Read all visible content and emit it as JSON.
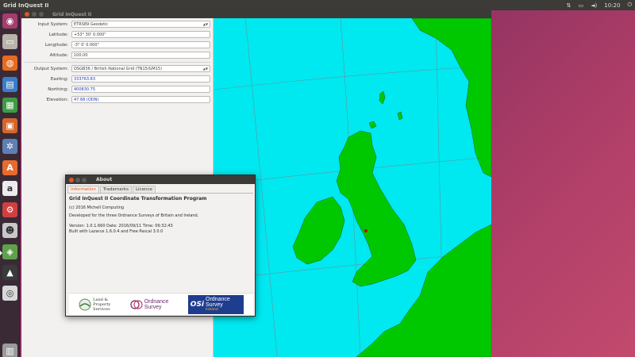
{
  "top_panel": {
    "title": "Grid InQuest II",
    "clock": "10:20"
  },
  "launcher": {
    "items": [
      {
        "name": "dash-home-icon",
        "color": "#a33d6d",
        "glyph": "◉"
      },
      {
        "name": "files-icon",
        "color": "#b9b4ab",
        "glyph": "▭"
      },
      {
        "name": "firefox-icon",
        "color": "#e66b1f",
        "glyph": "◍"
      },
      {
        "name": "writer-icon",
        "color": "#3a7dc9",
        "glyph": "▤"
      },
      {
        "name": "calc-icon",
        "color": "#3f9b45",
        "glyph": "▦"
      },
      {
        "name": "impress-icon",
        "color": "#d5652a",
        "glyph": "▣"
      },
      {
        "name": "settings-icon",
        "color": "#5f7fb3",
        "glyph": "✲"
      },
      {
        "name": "software-center-icon",
        "color": "#e86a2c",
        "glyph": "A"
      },
      {
        "name": "amazon-icon",
        "color": "#ececec",
        "glyph": "a"
      },
      {
        "name": "system-settings-icon",
        "color": "#d23f3f",
        "glyph": "⚙"
      },
      {
        "name": "user-accounts-icon",
        "color": "#c8c8c8",
        "glyph": "☻"
      },
      {
        "name": "grid-inquest-icon",
        "color": "#5fa14a",
        "glyph": "◈"
      },
      {
        "name": "inkscape-icon",
        "color": "#3a3a3a",
        "glyph": "▲"
      },
      {
        "name": "dvd-icon",
        "color": "#d8d8d8",
        "glyph": "◎"
      },
      {
        "name": "trash-icon",
        "color": "#9a9a9a",
        "glyph": "▥"
      }
    ]
  },
  "main_window": {
    "title": "Grid InQuest II",
    "input": {
      "system_label": "Input System:",
      "system_value": "ETRS89 Geodetic",
      "latitude_label": "Latitude:",
      "latitude_value": "+53° 30' 0.000\"",
      "longitude_label": "Longitude:",
      "longitude_value": "-3° 0' 0.000\"",
      "altitude_label": "Altitude:",
      "altitude_value": "100.00"
    },
    "output": {
      "system_label": "Output System:",
      "system_value": "OSGB36 / British National Grid (TN15/GM15)",
      "easting_label": "Easting:",
      "easting_value": "333763.83",
      "northing_label": "Northing:",
      "northing_value": "400830.75",
      "elevation_label": "Elevation:",
      "elevation_value": "47.68 (ODN)"
    }
  },
  "about_dialog": {
    "title": "About",
    "tabs": [
      "Information",
      "Trademarks",
      "Licence"
    ],
    "heading": "Grid InQuest II Coordinate Transformation Program",
    "copyright": "(c) 2016 Michell Computing",
    "developed": "Developed for the three Ordnance Surveys of Britain and Ireland.",
    "version": "Version: 1.0.1.660 Date: 2016/09/11 Time: 09:32:43",
    "built": "Built with Lazarus 1.6.0.4 and Free Pascal 3.0.0",
    "logos": {
      "lps_line1": "Land &",
      "lps_line2": "Property",
      "lps_line3": "Services",
      "osni_line1": "Ordnance",
      "osni_line2": "Survey",
      "osi_mark": "OSi",
      "osi_line1": "Ordnance",
      "osi_line2": "Survey",
      "osi_sub": "Ireland"
    }
  },
  "colors": {
    "sea": "#00e8f0",
    "land": "#00c800",
    "accent": "#e05a1d"
  }
}
